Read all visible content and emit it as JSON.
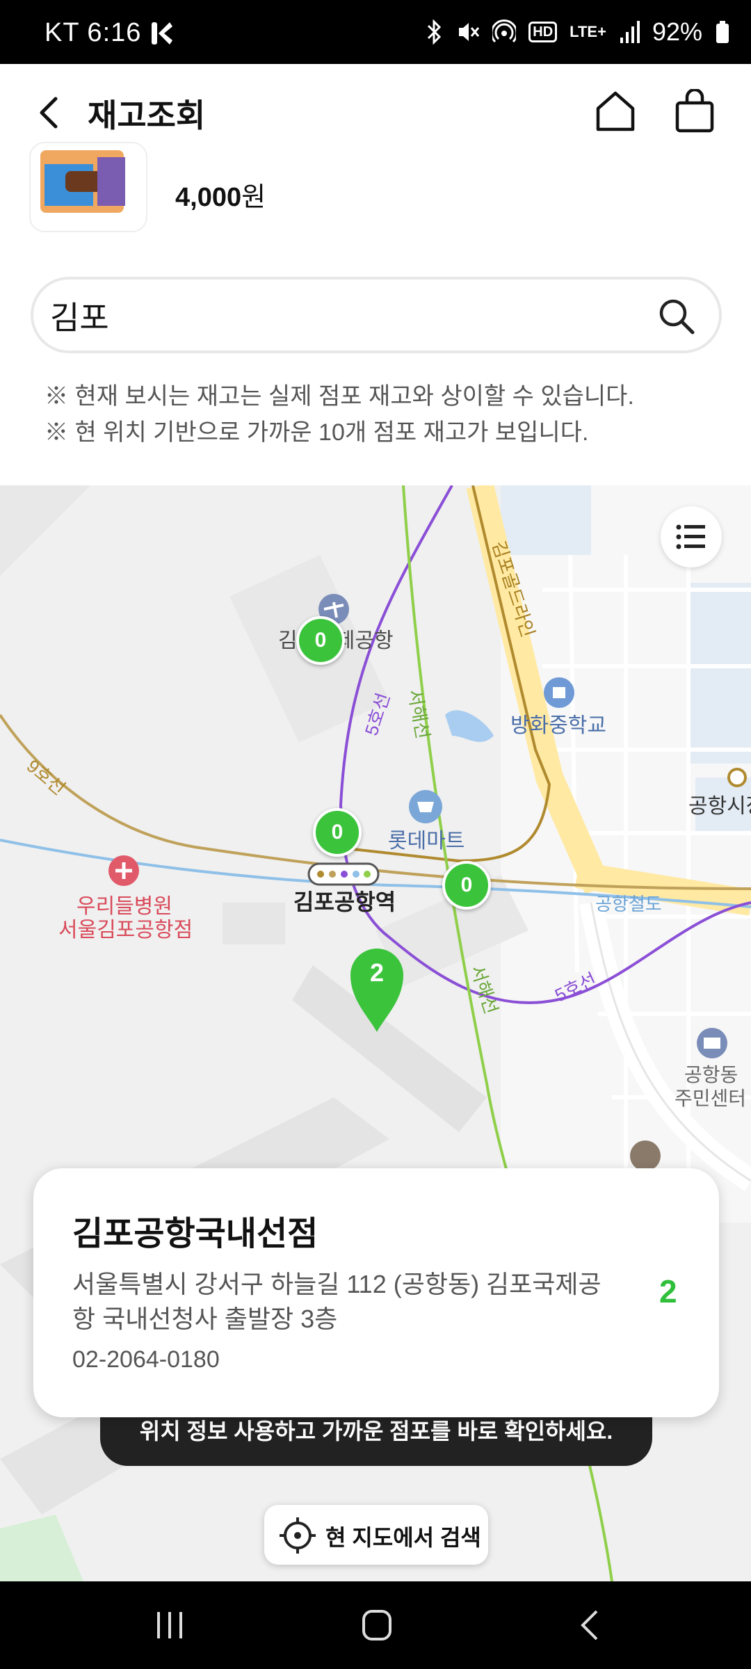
{
  "status_bar": {
    "carrier_time": "KT 6:16",
    "battery": "92%",
    "hd": "HD",
    "lte": "LTE+"
  },
  "header": {
    "title": "재고조회"
  },
  "product": {
    "price": "4,000",
    "currency": "원"
  },
  "search": {
    "value": "김포",
    "placeholder": ""
  },
  "notices": [
    "※ 현재 보시는 재고는 실제 점포 재고와 상이할 수 있습니다.",
    "※ 현 위치 기반으로 가까운 10개 점포 재고가 보입니다."
  ],
  "map": {
    "labels": {
      "airport": "김포국제공항",
      "school": "방화중학교",
      "mart": "롯데마트",
      "station": "김포공항역",
      "hospital_1": "우리들병원",
      "hospital_2": "서울김포공항점",
      "airport_rail": "공항철도",
      "line5_a": "5호선",
      "line5_b": "5호선",
      "seohae_a": "서해선",
      "seohae_b": "서해선",
      "line9": "9호선",
      "goldline": "김포골드라인",
      "community_1": "공항동",
      "community_2": "주민센터",
      "city": "공항시장"
    },
    "markers": [
      "0",
      "0",
      "0",
      "2"
    ]
  },
  "store_card": {
    "name": "김포공항국내선점",
    "address": "서울특별시 강서구 하늘길 112 (공항동) 김포국제공항 국내선청사 출발장 3층",
    "phone": "02-2064-0180",
    "count": "2"
  },
  "toast": "위치 정보 사용하고 가까운 점포를 바로 확인하세요.",
  "map_search_button": "현 지도에서 검색"
}
